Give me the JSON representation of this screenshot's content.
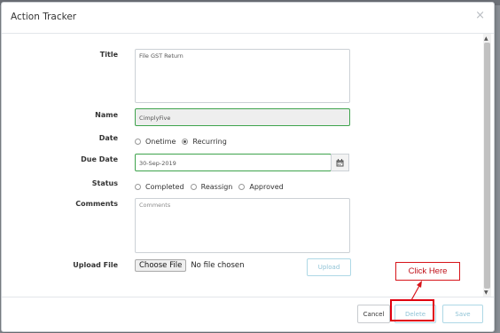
{
  "dialog": {
    "title": "Action Tracker",
    "close_glyph": "×"
  },
  "form": {
    "title_label": "Title",
    "title_value": "File GST Return",
    "name_label": "Name",
    "name_value": "CimplyFive",
    "date_label": "Date",
    "date_options": [
      "Onetime",
      "Recurring"
    ],
    "date_selected": "Recurring",
    "due_date_label": "Due Date",
    "due_date_value": "30-Sep-2019",
    "status_label": "Status",
    "status_options": [
      "Completed",
      "Reassign",
      "Approved"
    ],
    "comments_label": "Comments",
    "comments_placeholder": "Comments",
    "upload_label": "Upload File",
    "choose_file_label": "Choose File",
    "no_file_text": "No file chosen",
    "upload_button": "Upload"
  },
  "footer": {
    "cancel": "Cancel",
    "delete": "Delete",
    "save": "Save"
  },
  "annotation": {
    "callout_text": "Click Here",
    "highlight_color": "#e1000f"
  },
  "icons": {
    "calendar": "calendar-icon",
    "close": "close-icon"
  }
}
